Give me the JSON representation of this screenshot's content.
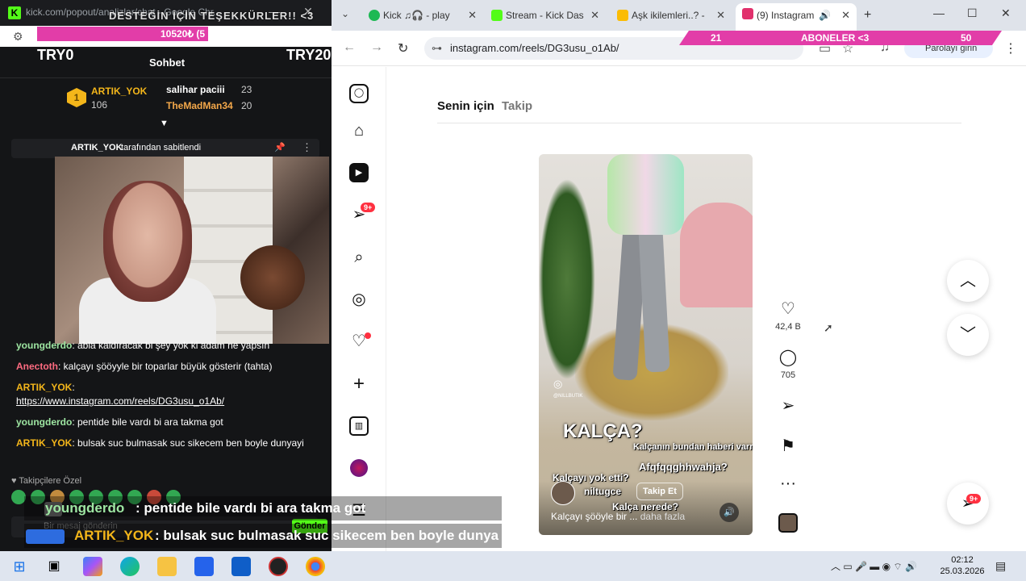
{
  "left_window": {
    "url": "kick.com/popout/analizlar/chat - Google Chr...",
    "donation_title": "DESTEĞİN İÇİN TEŞEKKÜRLER!! <3",
    "progress_text": "10520₺ (5",
    "try_left": "TRY0",
    "try_right": "TRY20",
    "chat_header": "Sohbet",
    "leaderboard": {
      "top": {
        "rank": "1",
        "name": "ARTIK_YOK",
        "count": "106"
      },
      "second": {
        "name": "salihar paciii",
        "count": "23"
      },
      "third": {
        "name": "TheMadMan34",
        "count": "20"
      }
    },
    "pinned": {
      "user": "ARTIK_YOK",
      "text": "tarafından sabitlendi"
    },
    "messages": [
      {
        "user": "youngderdo",
        "color": "#9ee6a2",
        "text": ": abla kaldıracak bi şey yok ki adam ne yapsın"
      },
      {
        "user": "Anectoth",
        "color": "#ff6b81",
        "text": ": kalçayı şööyyle bir toparlar büyük gösterir (tahta)"
      },
      {
        "user": "ARTIK_YOK",
        "color": "#f4b61a",
        "text": ":",
        "link": "https://www.instagram.com/reels/DG3usu_o1Ab/"
      },
      {
        "user": "youngderdo",
        "color": "#9ee6a2",
        "text": ": pentide bile vardı bi ara takma got"
      },
      {
        "user": "ARTIK_YOK",
        "color": "#f4b61a",
        "text": ": bulsak suc bulmasak suc sikecem ben boyle dunyayi"
      }
    ],
    "followers_only": "Takipçilere Özel",
    "input_placeholder": "Bir mesaj gönderin",
    "send_label": "Gönder"
  },
  "overlay": {
    "line1_user": "youngderdo",
    "line1_text": ": pentide bile vardı bi ara takma got",
    "line2_user": "ARTIK_YOK",
    "line2_text": ": bulsak suc bulmasak suc sikecem ben boyle dunya"
  },
  "browser": {
    "tabs": [
      {
        "label": "Kick ♫🎧 - play",
        "icon_color": "#1db954"
      },
      {
        "label": "Stream - Kick Das",
        "icon_color": "#53fc18"
      },
      {
        "label": "Aşk ikilemleri..? -",
        "icon_color": "#fbbc04"
      },
      {
        "label": "(9) Instagram",
        "icon_color": "#e1306c"
      }
    ],
    "new_tab": "+",
    "url": "instagram.com/reels/DG3usu_o1Ab/",
    "profile_label": "Parolayı girin",
    "aboneler": {
      "left_num": "21",
      "label": "ABONELER <3",
      "right_num": "50"
    }
  },
  "instagram": {
    "tabs": {
      "for_you": "Senin için",
      "following": "Takip"
    },
    "sidebar_badges": {
      "messages": "9+"
    },
    "reel": {
      "title_overlay": "KALÇA?",
      "caption_lines": [
        "Kalçanın bundan haberi varmı?",
        "Afqfqqghhwahja?",
        "Kalçayı yok etti?",
        "Kalça nerede?"
      ],
      "author": "niltugce",
      "follow_label": "Takip Et",
      "description": "Kalçayı şööyle bir ...",
      "more_label": "daha fazla",
      "watermark": "@NILLBUTIK"
    },
    "actions": {
      "likes": "42,4 B",
      "comments": "705"
    },
    "float_badge": "9+"
  },
  "taskbar": {
    "time": "02:12",
    "date": "25.03.2026"
  }
}
